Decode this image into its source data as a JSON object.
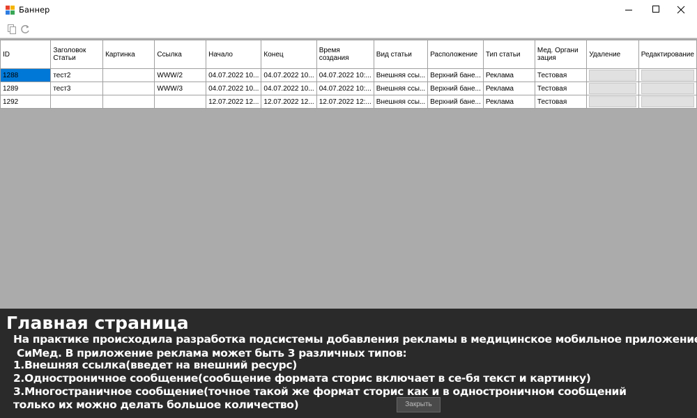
{
  "window": {
    "title": "Баннер",
    "close_button_label": "Закрыть"
  },
  "toolbar": {
    "icons": [
      "copy-icon",
      "refresh-icon"
    ]
  },
  "grid": {
    "columns": [
      "ID",
      "Заголовок Статьи",
      "Картинка",
      "Ссылка",
      "Начало",
      "Конец",
      "Время создания",
      "Вид статьи",
      "Расположение",
      "Тип статьи",
      "Мед. Органи зация",
      "Удаление",
      "Редактирование"
    ],
    "rows": [
      [
        "1288",
        "тест2",
        "",
        "WWW/2",
        "04.07.2022 10...",
        "04.07.2022 10...",
        "04.07.2022 10:...",
        "Внешняя ссы...",
        "Верхний бане...",
        "Реклама",
        "Тестовая",
        "",
        ""
      ],
      [
        "1289",
        "тест3",
        "",
        "WWW/3",
        "04.07.2022 10...",
        "04.07.2022 10...",
        "04.07.2022 10:...",
        "Внешняя ссы...",
        "Верхний бане...",
        "Реклама",
        "Тестовая",
        "",
        ""
      ],
      [
        "1292",
        "",
        "",
        "",
        "12.07.2022 12...",
        "12.07.2022 12...",
        "12.07.2022 12:...",
        "Внешняя ссы...",
        "Верхний бане...",
        "Реклама",
        "Тестовая",
        "",
        ""
      ]
    ]
  },
  "overlay": {
    "heading": "Главная страница",
    "lines": [
      "На практике происходила разработка подсистемы добавления рекламы в медицинское мобильное приложение",
      " СиМед. В приложение реклама может быть 3 различных типов:",
      "1.Внешняя ссылка(введет на внешний ресурс)",
      "2.Одностроничное сообщение(сообщение формата сторис включает в се-бя текст и картинку)",
      "3.Многостраничное сообщение(точное такой же формат сторис как и в одностроничном сообщений",
      "только их можно делать большое количество)"
    ]
  },
  "colors": {
    "selection": "#0078d7",
    "background": "#ababab",
    "overlay": "#2a2a2a"
  }
}
